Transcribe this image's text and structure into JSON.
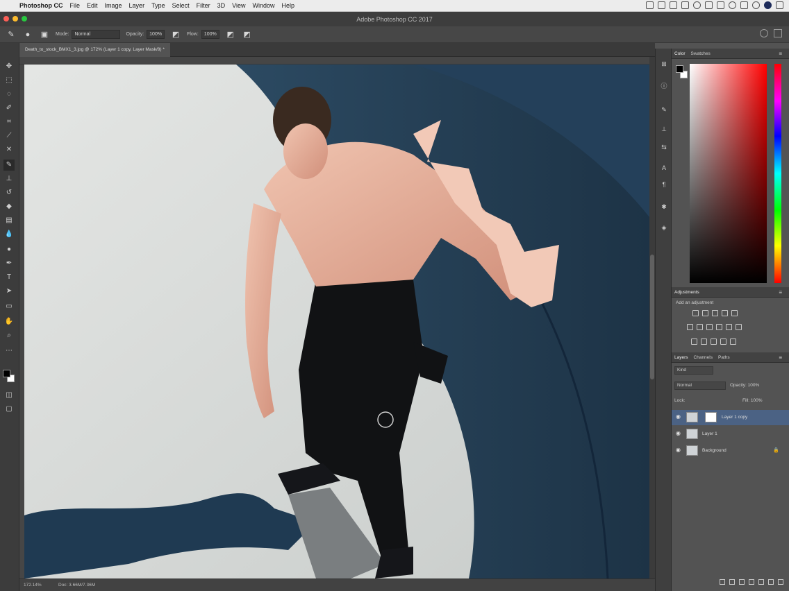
{
  "menubar": {
    "app": "Photoshop CC",
    "items": [
      "File",
      "Edit",
      "Image",
      "Layer",
      "Type",
      "Select",
      "Filter",
      "3D",
      "View",
      "Window",
      "Help"
    ]
  },
  "window": {
    "title": "Adobe Photoshop CC 2017"
  },
  "options": {
    "mode_label": "Mode:",
    "mode_value": "Normal",
    "opacity_label": "Opacity:",
    "opacity_value": "100%",
    "flow_label": "Flow:",
    "flow_value": "100%"
  },
  "document": {
    "tab_label": "Death_to_stock_BMX1_3.jpg @ 172% (Layer 1 copy, Layer Mask/8) *"
  },
  "status": {
    "zoom": "172.14%",
    "doc": "Doc: 3.66M/7.36M"
  },
  "color_panel": {
    "tabs": [
      "Color",
      "Swatches"
    ]
  },
  "adjustments_panel": {
    "title": "Adjustments",
    "subtitle": "Add an adjustment"
  },
  "layers_panel": {
    "tabs": [
      "Layers",
      "Channels",
      "Paths"
    ],
    "kind_label": "Kind",
    "blend_mode": "Normal",
    "opacity_label": "Opacity: 100%",
    "lock_label": "Lock:",
    "fill_label": "Fill: 100%",
    "layers": [
      {
        "name": "Layer 1 copy",
        "selected": true
      },
      {
        "name": "Layer 1",
        "selected": false
      },
      {
        "name": "Background",
        "selected": false
      }
    ]
  },
  "colors": {
    "accent": "#4b6284",
    "panel_bg": "#535353",
    "chrome": "#3c3c3c"
  }
}
